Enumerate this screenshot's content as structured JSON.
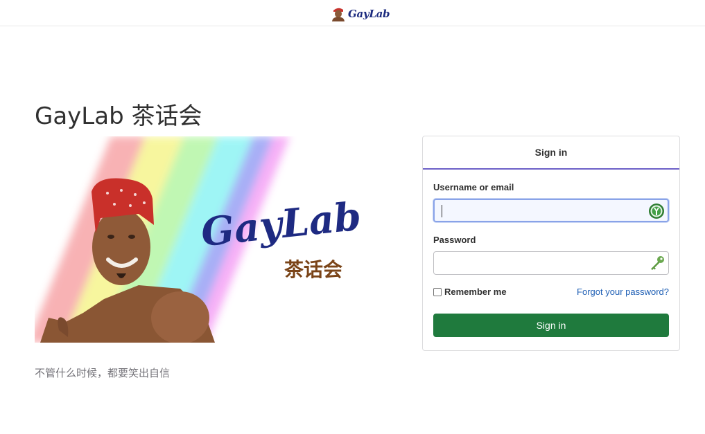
{
  "header": {
    "brand_text": "GayLab",
    "brand_icon": "ricardo-avatar"
  },
  "page": {
    "title": "GayLab 茶话会",
    "tagline": "不管什么时候，都要笑出自信"
  },
  "hero": {
    "logo_text": "GayLab",
    "logo_subtitle": "茶话会",
    "image_subject": "smiling man in red bandana over rainbow stripes"
  },
  "login": {
    "tab_label": "Sign in",
    "username_label": "Username or email",
    "username_value": "",
    "username_icon": "password-manager-icon",
    "password_label": "Password",
    "password_value": "",
    "password_icon": "key-icon",
    "remember_label": "Remember me",
    "remember_checked": false,
    "forgot_label": "Forgot your password?",
    "submit_label": "Sign in"
  },
  "colors": {
    "tab_underline": "#6c5fc7",
    "submit_bg": "#1f7a3d",
    "link": "#1f5fb5",
    "focus_border": "#89a3e8"
  }
}
